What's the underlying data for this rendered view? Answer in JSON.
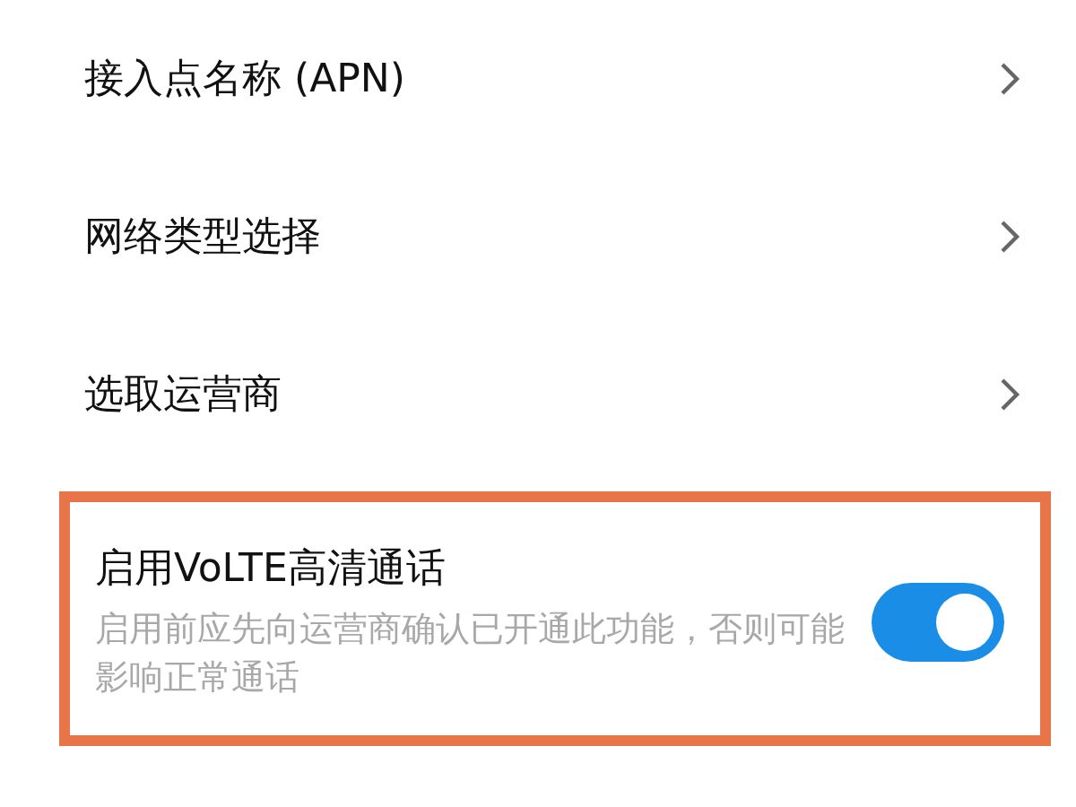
{
  "settings": [
    {
      "kind": "link",
      "title": "接入点名称 (APN)"
    },
    {
      "kind": "link",
      "title": "网络类型选择"
    },
    {
      "kind": "link",
      "title": "选取运营商"
    },
    {
      "kind": "switch",
      "title": "启用VoLTE高清通话",
      "subtitle": "启用前应先向运营商确认已开通此功能，否则可能影响正常通话",
      "on": true,
      "highlighted": true
    }
  ]
}
